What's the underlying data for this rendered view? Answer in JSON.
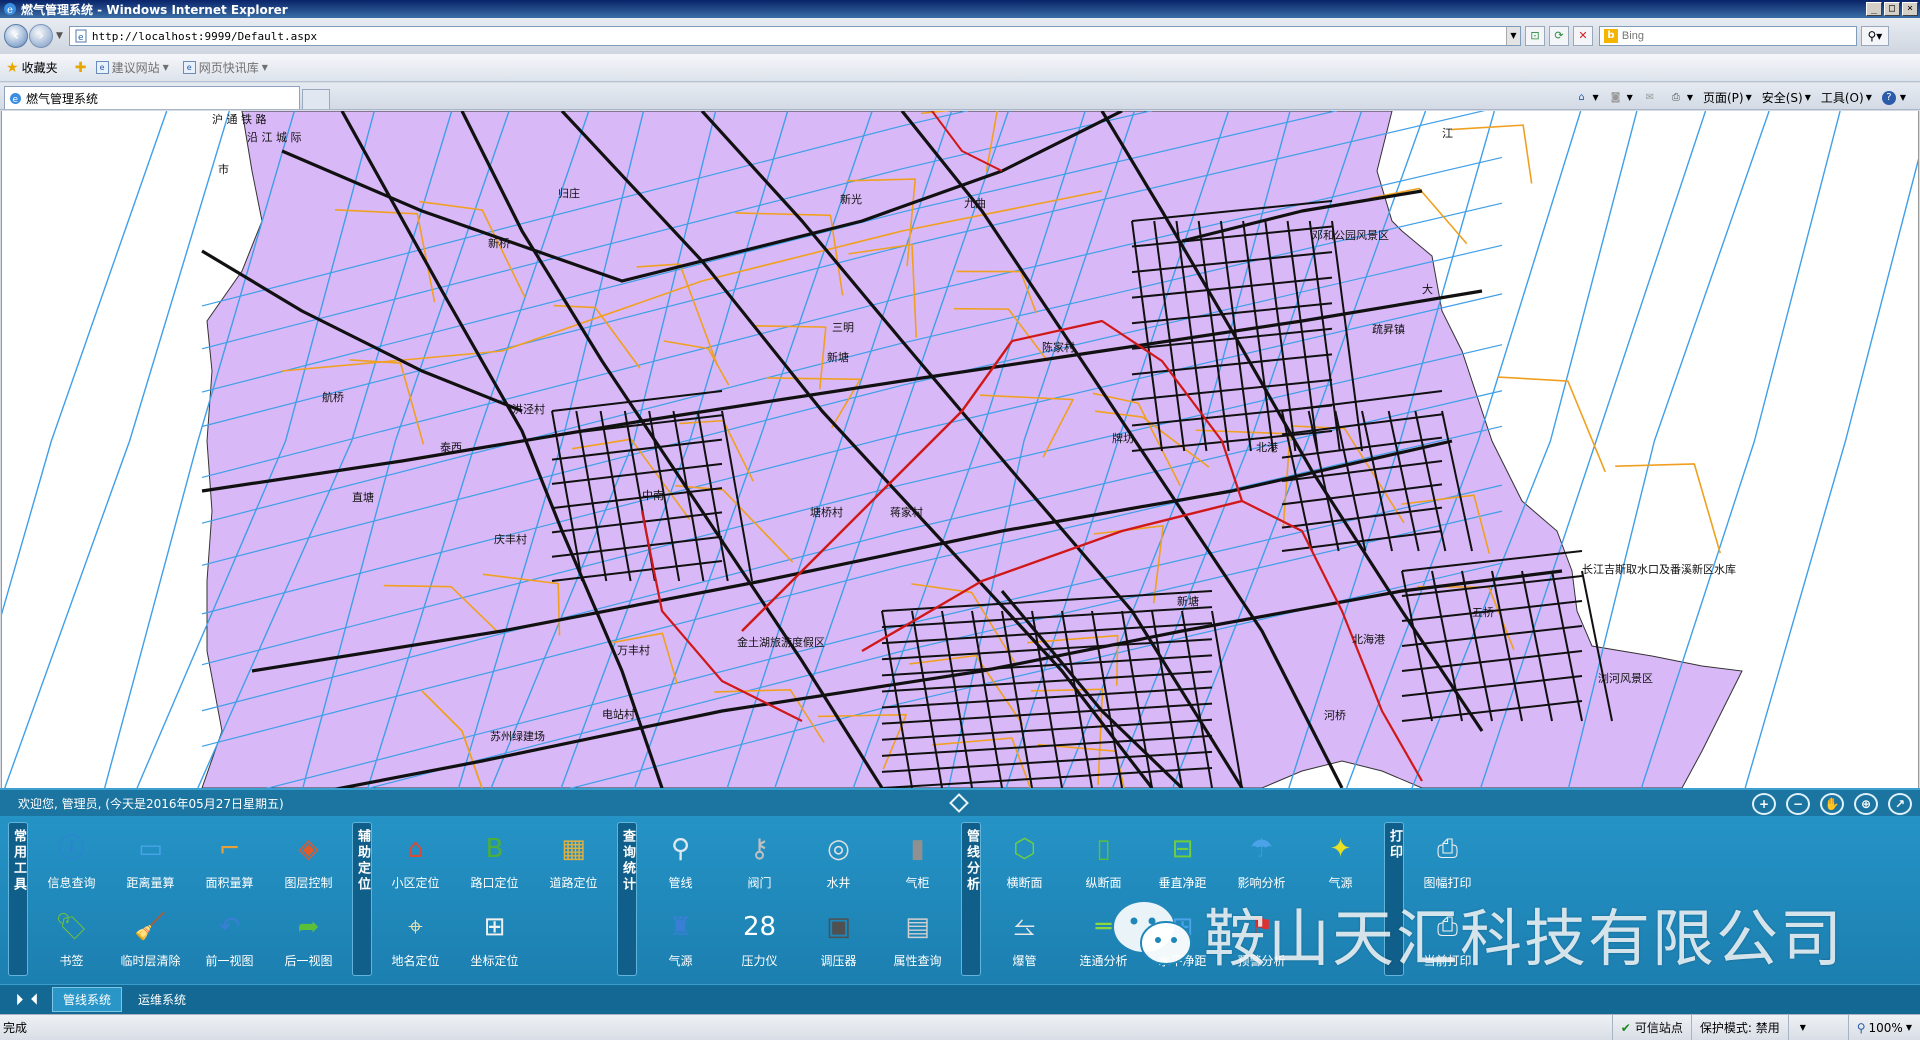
{
  "window": {
    "title": "燃气管理系统 - Windows Internet Explorer",
    "min": "_",
    "max": "□",
    "close": "×"
  },
  "address": {
    "url": "http://localhost:9999/Default.aspx",
    "search_placeholder": "Bing",
    "search_engine_icon": "b"
  },
  "favorites": {
    "label": "收藏夹",
    "items": [
      "建议网站",
      "网页快讯库"
    ]
  },
  "tab": {
    "title": "燃气管理系统"
  },
  "commandbar": {
    "page": "页面(P)",
    "safety": "安全(S)",
    "tools": "工具(O)",
    "help": "?"
  },
  "infobar": {
    "welcome": "欢迎您, 管理员, (今天是2016年05月27日星期五)"
  },
  "map": {
    "labels": [
      {
        "text": "沪  通  铁  路"
      },
      {
        "text": "沿  江  城  际"
      },
      {
        "text": "市"
      },
      {
        "text": "江"
      },
      {
        "text": "归庄"
      },
      {
        "text": "新光"
      },
      {
        "text": "九曲"
      },
      {
        "text": "邓和公园风景区"
      },
      {
        "text": "疏昇镇"
      },
      {
        "text": "大"
      },
      {
        "text": "航桥"
      },
      {
        "text": "陈家村"
      },
      {
        "text": "三明"
      },
      {
        "text": "新塘"
      },
      {
        "text": "新桥"
      },
      {
        "text": "洪泾村"
      },
      {
        "text": "泰西"
      },
      {
        "text": "牌坊"
      },
      {
        "text": "中南"
      },
      {
        "text": "庆丰村"
      },
      {
        "text": "直塘"
      },
      {
        "text": "塘桥村"
      },
      {
        "text": "蒋家村"
      },
      {
        "text": "北港"
      },
      {
        "text": "新塘"
      },
      {
        "text": "万丰村"
      },
      {
        "text": "电站村"
      },
      {
        "text": "苏州绿建场"
      },
      {
        "text": "长江吉斯取水口及番溪新区水库"
      },
      {
        "text": "浏河风景区"
      },
      {
        "text": "河桥"
      },
      {
        "text": "北海港"
      },
      {
        "text": "金土湖旅游度假区"
      },
      {
        "text": "五桥"
      }
    ]
  },
  "groups": [
    {
      "label": "常用工具",
      "tools": [
        {
          "label": "信息查询",
          "icon": "ⓘ",
          "color": "#2f7fd6"
        },
        {
          "label": "书签",
          "icon": "🏷",
          "color": "#6fbf3a"
        },
        {
          "label": "距离量算",
          "icon": "▭",
          "color": "#4aa3e8"
        },
        {
          "label": "临时层清除",
          "icon": "🧹",
          "color": "#e0a020"
        },
        {
          "label": "面积量算",
          "icon": "⌐",
          "color": "#e6a13a"
        },
        {
          "label": "前一视图",
          "icon": "↶",
          "color": "#3a7fd6"
        },
        {
          "label": "图层控制",
          "icon": "◈",
          "color": "#e05a2a"
        },
        {
          "label": "后一视图",
          "icon": "➦",
          "color": "#5cbf3a"
        }
      ]
    },
    {
      "label": "辅助定位",
      "tools": [
        {
          "label": "小区定位",
          "icon": "⌂",
          "color": "#d84a3a"
        },
        {
          "label": "地名定位",
          "icon": "⌖",
          "color": "#e8e0b0"
        },
        {
          "label": "路口定位",
          "icon": "B",
          "color": "#4caf3a"
        },
        {
          "label": "坐标定位",
          "icon": "⊞",
          "color": "#f0f0f0"
        },
        {
          "label": "道路定位",
          "icon": "▦",
          "color": "#e0b040"
        }
      ]
    },
    {
      "label": "查询统计",
      "tools": [
        {
          "label": "管线",
          "icon": "⚲",
          "color": "#e0e8f0"
        },
        {
          "label": "气源",
          "icon": "♜",
          "color": "#3a7fd6"
        },
        {
          "label": "阀门",
          "icon": "⚷",
          "color": "#c0c0c0"
        },
        {
          "label": "压力仪",
          "icon": "28",
          "color": "#ffffff"
        },
        {
          "label": "水井",
          "icon": "◎",
          "color": "#e0e0e0"
        },
        {
          "label": "调压器",
          "icon": "▣",
          "color": "#505050"
        },
        {
          "label": "气柜",
          "icon": "▮",
          "color": "#909090"
        },
        {
          "label": "属性查询",
          "icon": "▤",
          "color": "#d0d0d0"
        }
      ]
    },
    {
      "label": "管线分析",
      "tools": [
        {
          "label": "横断面",
          "icon": "⬡",
          "color": "#6fcf3a"
        },
        {
          "label": "爆管",
          "icon": "⥦",
          "color": "#e8e8e8"
        },
        {
          "label": "纵断面",
          "icon": "▯",
          "color": "#5cbf3a"
        },
        {
          "label": "连通分析",
          "icon": "═",
          "color": "#8fd63a"
        },
        {
          "label": "垂直净距",
          "icon": "⊟",
          "color": "#6fcf3a"
        },
        {
          "label": "水平净距",
          "icon": "⊞",
          "color": "#4aa3e8"
        },
        {
          "label": "影响分析",
          "icon": "☂",
          "color": "#4aa3e8"
        },
        {
          "label": "预警分析",
          "icon": "⚑",
          "color": "#e03030"
        },
        {
          "label": "气源",
          "icon": "✦",
          "color": "#e8e020"
        }
      ]
    },
    {
      "label": "打印",
      "tools": [
        {
          "label": "图幅打印",
          "icon": "⎙",
          "color": "#f0f0f0"
        },
        {
          "label": "当前打印",
          "icon": "⎙",
          "color": "#f0f0f0"
        }
      ]
    }
  ],
  "watermark": {
    "text": "鞍山天汇科技有限公司"
  },
  "systabs": {
    "items": [
      "管线系统",
      "运维系统"
    ]
  },
  "status": {
    "left": "完成",
    "trusted": "可信站点",
    "protected": "保护模式: 禁用",
    "zoom": "100%"
  },
  "colors": {
    "map_fill": "#d9b8f7",
    "map_road": "#111111",
    "map_water": "#3f9fe8",
    "map_gas": "#f0a020",
    "map_main": "#d01818",
    "panel": "#1f86b8"
  }
}
